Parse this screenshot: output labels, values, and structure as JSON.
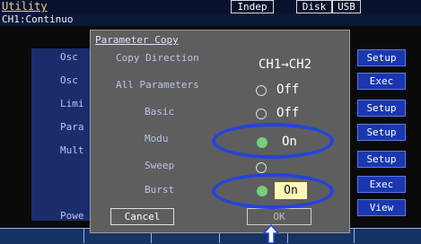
{
  "header": {
    "title": "Utility",
    "tags": {
      "indep": "Indep",
      "disk": "Disk",
      "usb": "USB"
    },
    "channel_mode": "CH1:Continuo"
  },
  "background_menu": {
    "items": [
      "Osc",
      "Osc",
      "Limi",
      "Para",
      "Mult",
      "Powe"
    ]
  },
  "softkeys": [
    "Setup",
    "Exec",
    "Setup",
    "Setup",
    "Setup",
    "Exec",
    "View"
  ],
  "dialog": {
    "title": "Parameter Copy",
    "rows": [
      {
        "label": "Copy Direction",
        "value": "CH1→CH2"
      },
      {
        "label": "All Parameters",
        "value": "Off",
        "selected": false
      },
      {
        "label": "Basic",
        "value": "Off",
        "selected": false
      },
      {
        "label": "Modu",
        "value": "On",
        "selected": true
      },
      {
        "label": "Sweep",
        "value": "",
        "selected": false
      },
      {
        "label": "Burst",
        "value": "On",
        "selected": true
      }
    ],
    "cancel_label": "Cancel",
    "ok_label": "OK"
  },
  "colors": {
    "highlight": "#2443dc",
    "radio_on": "#74d07b",
    "softkey": "#1a37b0"
  }
}
